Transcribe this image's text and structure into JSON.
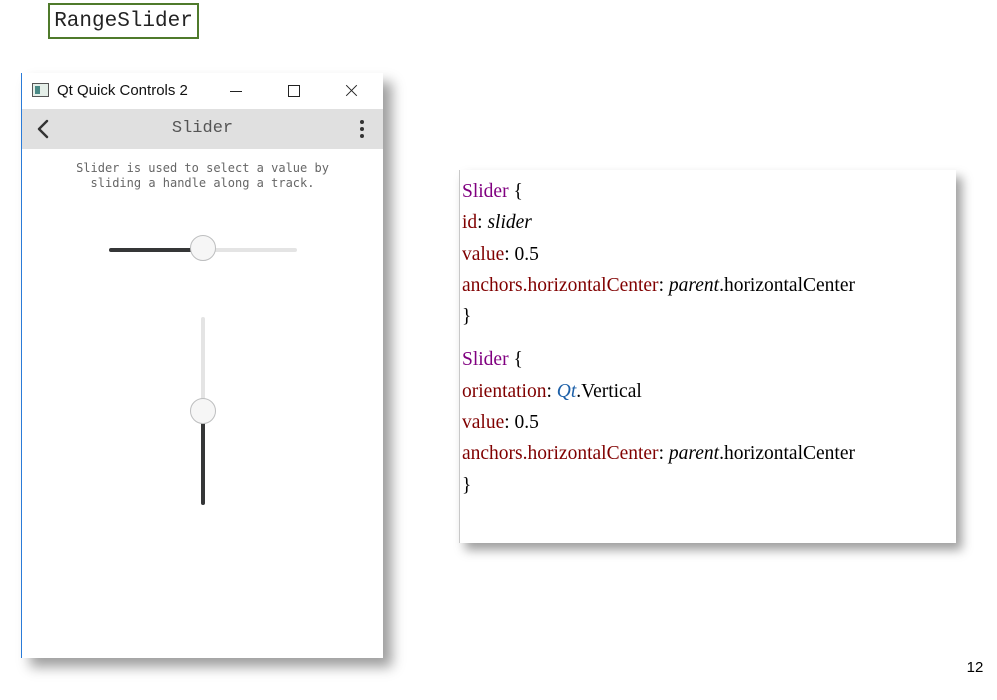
{
  "slide": {
    "title": "RangeSlider",
    "page_number": "12"
  },
  "window": {
    "title": "Qt Quick Controls 2",
    "controls": [
      "minimize-icon",
      "maximize-icon",
      "close-icon"
    ],
    "toolbar": {
      "back_icon": "chevron-left-icon",
      "title": "Slider",
      "menu_icon": "vertical-ellipsis-icon"
    },
    "description": "Slider is used to select a value by\nsliding a handle along a track.",
    "sliders": {
      "horizontal": {
        "orientation": "horizontal",
        "value": 0.5
      },
      "vertical": {
        "orientation": "vertical",
        "value": 0.5
      }
    },
    "colors": {
      "toolbar_bg": "#e0e0e0",
      "track": "#e4e4e4",
      "fill": "#353637",
      "handle": "#f6f6f6",
      "accent_border": "#2a7bd8"
    }
  },
  "code": {
    "block1": {
      "line1": {
        "type": "Slider",
        "brace": " {"
      },
      "line2": {
        "prop": "id",
        "colon": ": ",
        "value": "slider"
      },
      "line3": {
        "prop": "value",
        "colon": ": ",
        "value": "0.5"
      },
      "line4": {
        "prop": "anchors.horizontalCenter",
        "colon": ": ",
        "obj": "parent",
        "rest": ".horizontalCenter"
      },
      "line5": {
        "brace": "}"
      }
    },
    "block2": {
      "line1": {
        "type": "Slider",
        "brace": " {"
      },
      "line2": {
        "prop": "orientation",
        "colon": ": ",
        "obj": "Qt",
        "rest": ".Vertical"
      },
      "line3": {
        "prop": "value",
        "colon": ": ",
        "value": "0.5"
      },
      "line4": {
        "prop": "anchors.horizontalCenter",
        "colon": ": ",
        "obj": "parent",
        "rest": ".horizontalCenter"
      },
      "line5": {
        "brace": "}"
      }
    },
    "colors": {
      "keyword": "#800080",
      "property": "#800000",
      "qt": "#1d60a8"
    }
  }
}
